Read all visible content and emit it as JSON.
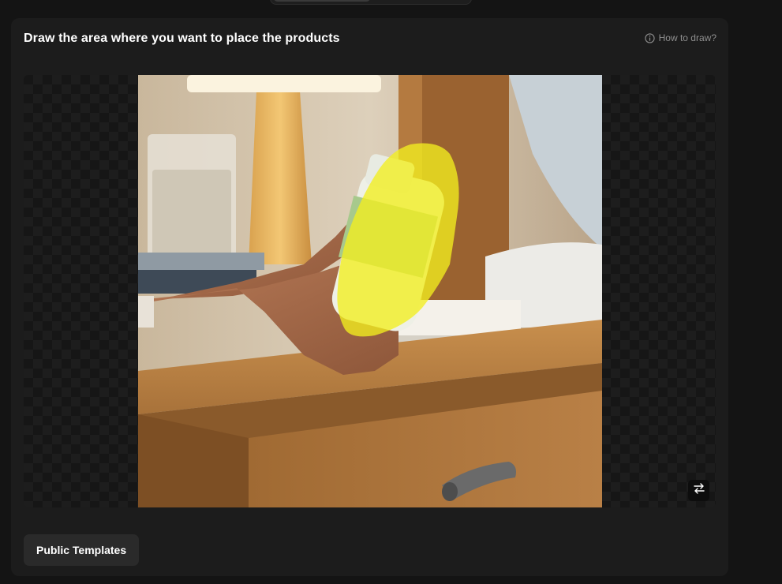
{
  "header": {
    "title": "Draw the area where you want to place the products",
    "help_label": "How to draw?",
    "help_icon": "info-circle-icon"
  },
  "canvas": {
    "photo_description_icon": "product-photo",
    "swap_icon": "swap-arrows-icon",
    "mask_color": "#f2ee1f"
  },
  "bottom": {
    "templates_label": "Public Templates"
  },
  "colors": {
    "background": "#141414",
    "panel": "#1c1c1c",
    "accent_mask": "#f2ee1f"
  }
}
